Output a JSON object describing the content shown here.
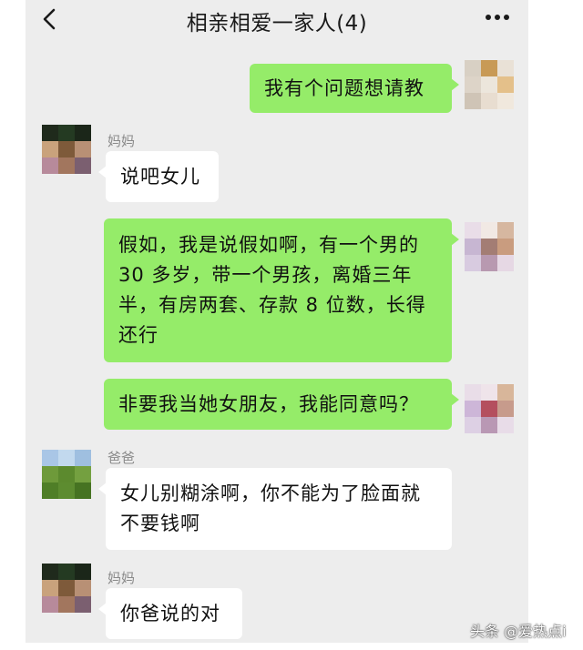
{
  "header": {
    "title": "相亲相爱一家人(4)",
    "back_icon": "chevron-left-icon",
    "more_icon": "more-dots-icon"
  },
  "messages": [
    {
      "side": "me",
      "sender": "",
      "text": "我有个问题想请教"
    },
    {
      "side": "them",
      "sender": "妈妈",
      "text": "说吧女儿"
    },
    {
      "side": "me",
      "sender": "",
      "lines": [
        "假如，我是说假如啊，有一个男的",
        "30 多岁，带一个男孩，离婚三年",
        "半，有房两套、存款 8 位数，长得",
        "还行"
      ]
    },
    {
      "side": "me",
      "sender": "",
      "text": "非要我当她女朋友，我能同意吗？"
    },
    {
      "side": "them",
      "sender": "爸爸",
      "lines": [
        "女儿别糊涂啊，你不能为了脸面就",
        "不要钱啊"
      ]
    },
    {
      "side": "them",
      "sender": "妈妈",
      "text": "你爸说的对"
    }
  ],
  "watermark": "头条 @爱热点i",
  "colors": {
    "background": "#ededed",
    "my_bubble": "#95ec69",
    "their_bubble": "#ffffff"
  }
}
